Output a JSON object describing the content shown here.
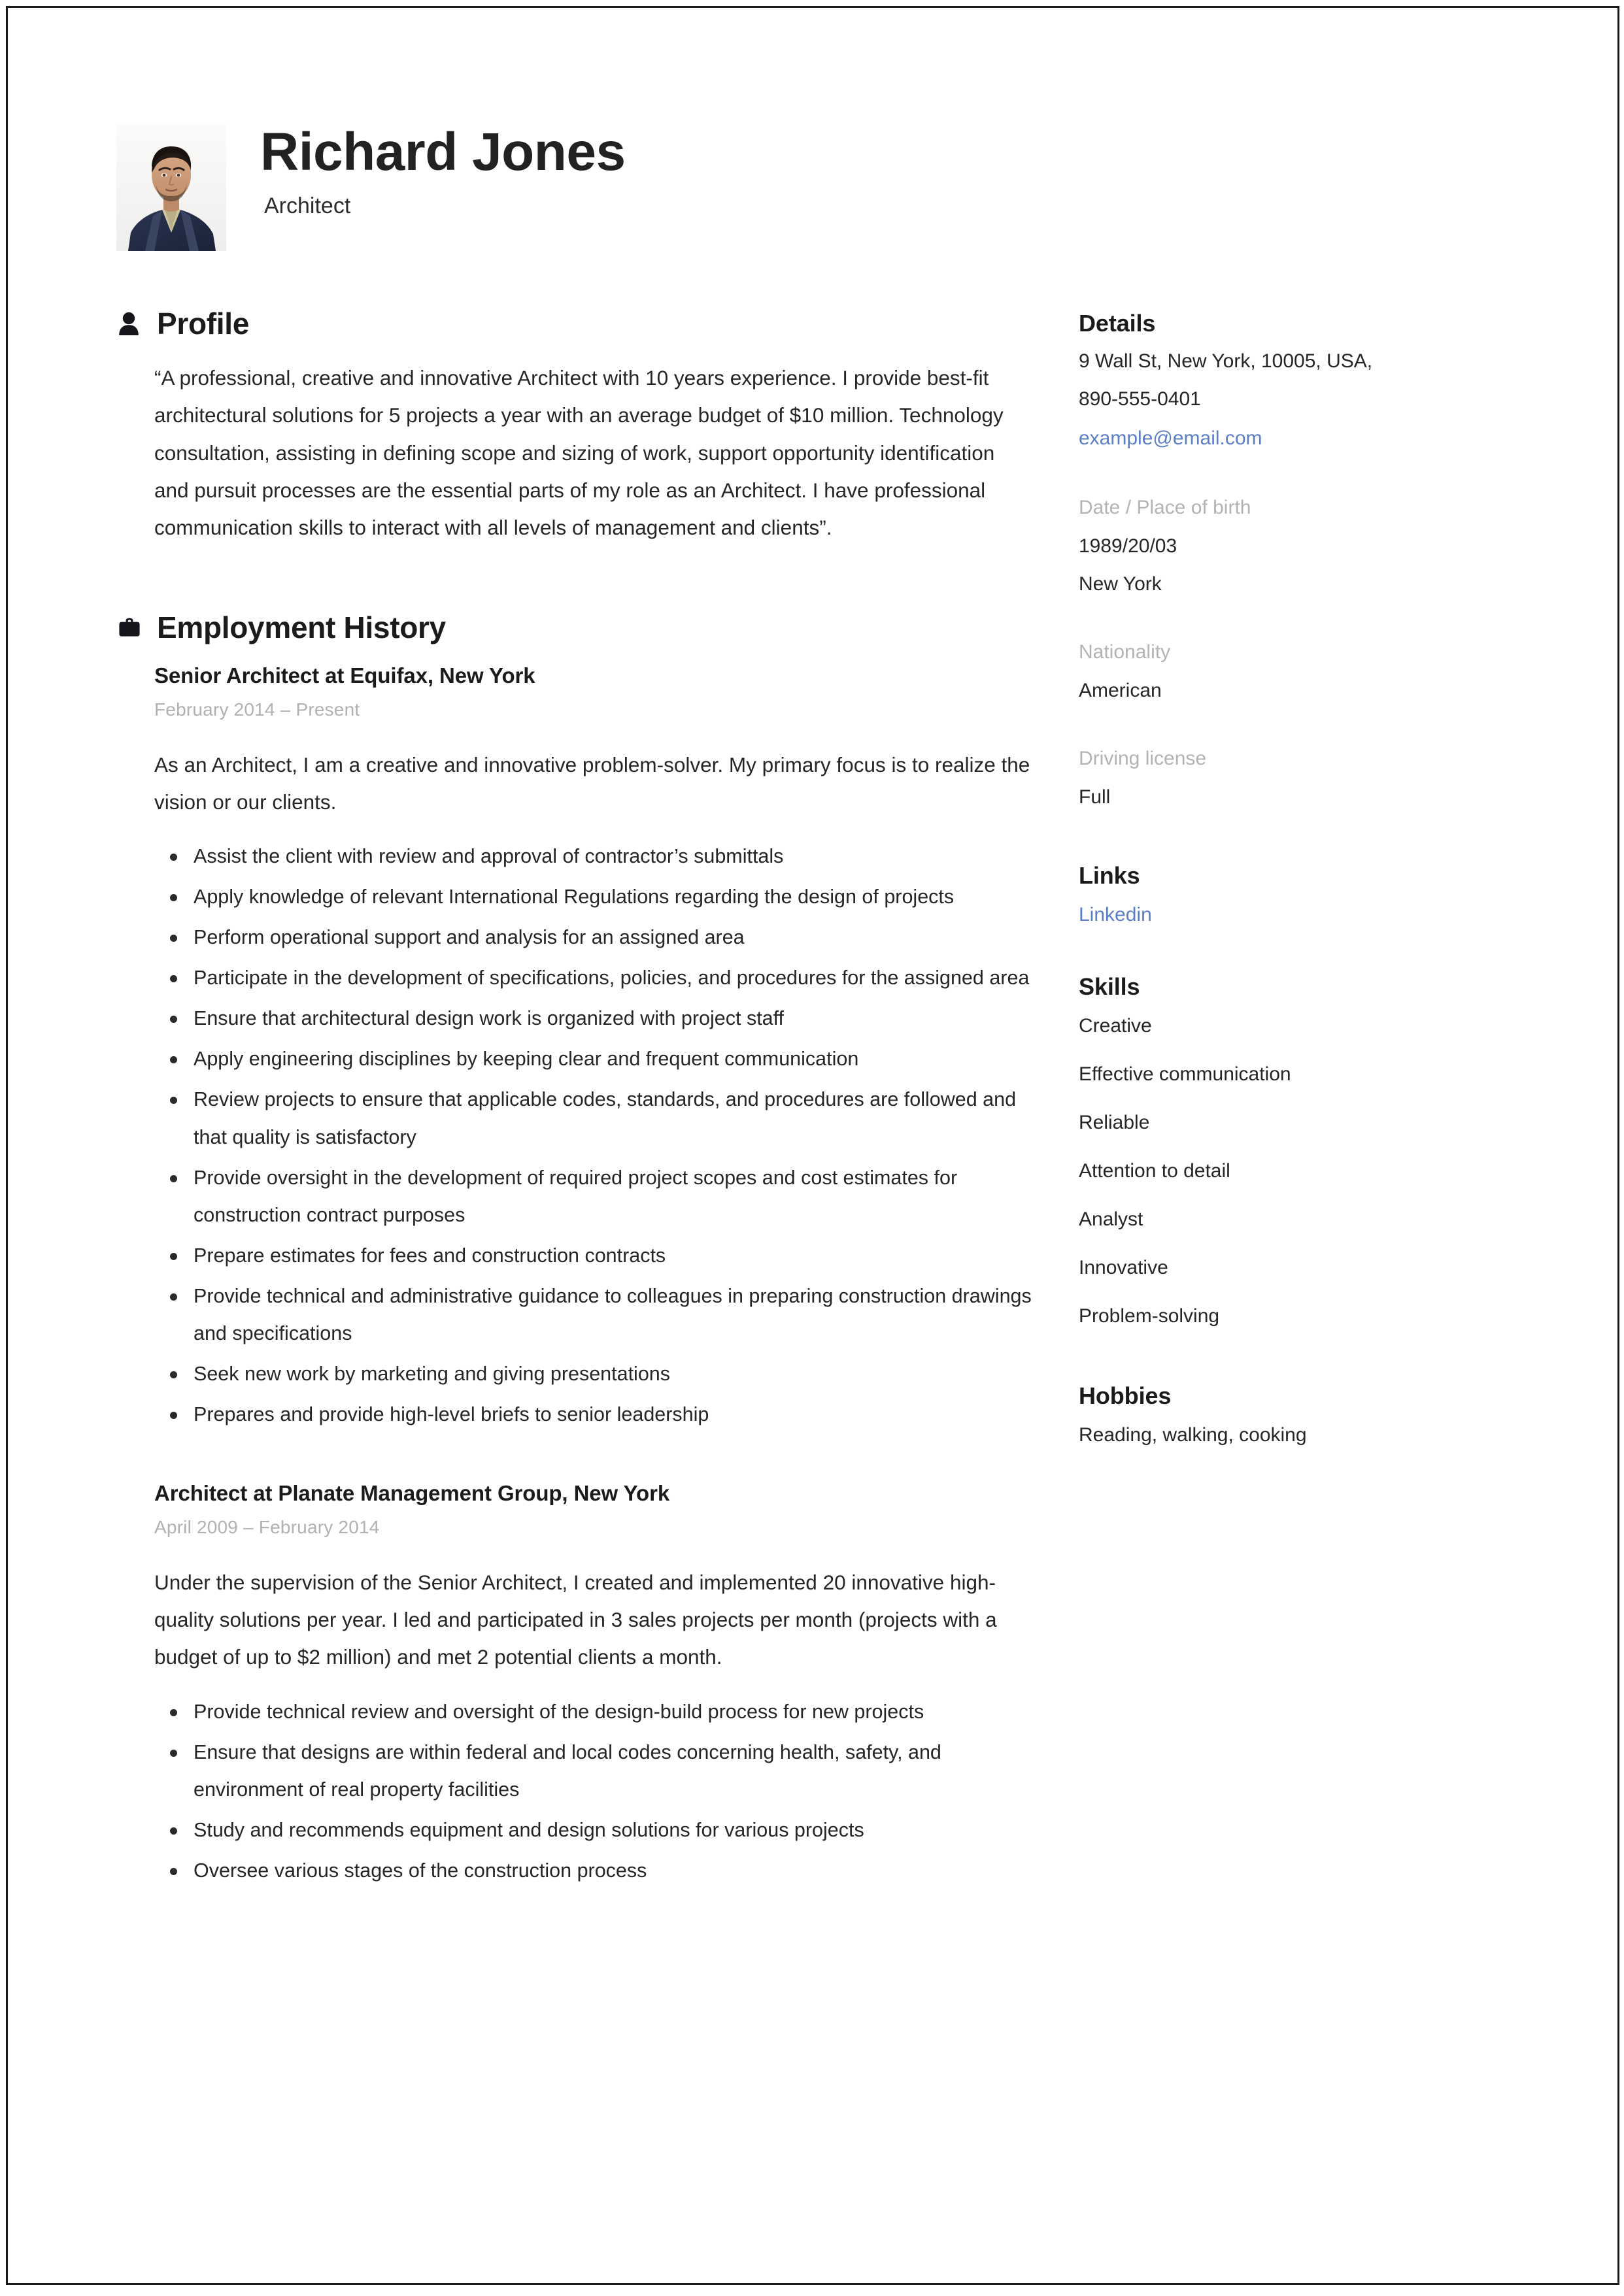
{
  "header": {
    "name": "Richard Jones",
    "title": "Architect",
    "avatar_icon": "portrait-photo"
  },
  "main": {
    "profile": {
      "icon": "person-icon",
      "heading": "Profile",
      "text": "“A professional, creative and innovative Architect with 10 years experience. I provide best-fit architectural solutions for 5 projects a year with an average budget of $10 million. Technology consultation, assisting in defining scope and sizing of work, support opportunity identification and pursuit processes are the essential parts of my role as an Architect. I have professional communication skills to interact with all levels of management and clients”."
    },
    "employment": {
      "icon": "briefcase-icon",
      "heading": "Employment History",
      "jobs": [
        {
          "heading": "Senior Architect at Equifax, New York",
          "dates": "February 2014  –  Present",
          "summary": "As an Architect, I am a creative and innovative problem-solver. My primary focus is to realize the vision or our clients.",
          "bullets": [
            "Assist the client with review and approval of contractor’s submittals",
            "Apply knowledge of relevant International Regulations regarding the design of projects",
            "Perform operational support and analysis for an assigned area",
            "Participate in the development of specifications, policies, and procedures for the assigned area",
            "Ensure that architectural design work is organized with project staff",
            "Apply engineering disciplines by keeping clear and frequent communication",
            "Review projects to ensure that applicable codes, standards, and procedures are followed and that quality is satisfactory",
            "Provide oversight in the development of required project scopes and cost estimates for construction contract purposes",
            "Prepare estimates for fees and construction contracts",
            "Provide technical and administrative guidance to colleagues in preparing construction drawings and specifications",
            "Seek new work by marketing and giving presentations",
            "Prepares and provide high-level briefs to senior leadership"
          ]
        },
        {
          "heading": "Architect at Planate Management Group, New York",
          "dates": "April 2009  –  February 2014",
          "summary": "Under the supervision of the Senior Architect, I created and implemented 20 innovative high-quality solutions per year. I led and participated in 3 sales projects per month (projects with a budget of up to $2 million) and met 2 potential clients a month.",
          "bullets": [
            "Provide technical review and oversight of the design-build process for new projects",
            "Ensure that designs are within federal and local codes concerning health, safety, and environment of real property facilities",
            "Study and recommends equipment and design solutions for various projects",
            "Oversee various stages of the construction process"
          ]
        }
      ]
    }
  },
  "sidebar": {
    "details": {
      "heading": "Details",
      "address": "9 Wall St, New York, 10005, USA,",
      "phone": "890-555-0401",
      "email": "example@email.com",
      "birth_label": "Date / Place of birth",
      "birth_date": "1989/20/03",
      "birth_place": "New York",
      "nationality_label": "Nationality",
      "nationality": "American",
      "license_label": "Driving license",
      "license": "Full"
    },
    "links": {
      "heading": "Links",
      "items": [
        "Linkedin"
      ]
    },
    "skills": {
      "heading": "Skills",
      "items": [
        "Creative",
        "Effective communication",
        "Reliable",
        "Attention to detail",
        "Analyst",
        "Innovative",
        "Problem-solving"
      ]
    },
    "hobbies": {
      "heading": "Hobbies",
      "text": "Reading, walking, cooking"
    }
  },
  "colors": {
    "link": "#5b7fc7",
    "muted_label": "#b3b3b3",
    "date_muted": "#b1b1b1",
    "text": "#262626",
    "heading": "#1b1b1b"
  }
}
